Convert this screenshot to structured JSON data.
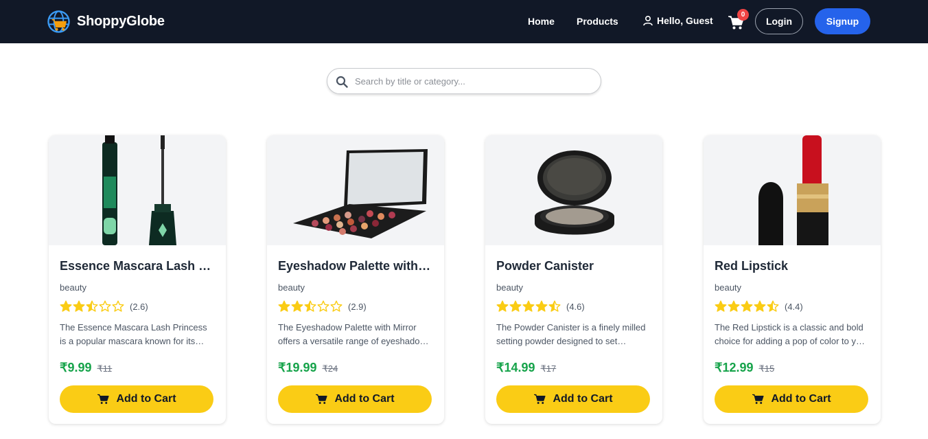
{
  "brand": {
    "name": "ShoppyGlobe",
    "logo_icon": "globe-cart-logo-icon"
  },
  "nav": {
    "home": "Home",
    "products": "Products",
    "user_greeting": "Hello, Guest",
    "user_icon": "user-icon",
    "cart_icon": "cart-icon",
    "cart_count": "0",
    "login": "Login",
    "signup": "Signup"
  },
  "colors": {
    "navbar": "#111827",
    "accent": "#2563eb",
    "badge": "#ef4444",
    "price": "#16a34a",
    "button": "#facc15",
    "star": "#facc15"
  },
  "search": {
    "placeholder": "Search by title or category...",
    "value": "",
    "icon": "search-icon"
  },
  "products": [
    {
      "title": "Essence Mascara Lash Princess",
      "category": "beauty",
      "rating": 2.6,
      "rating_label": "(2.6)",
      "description": "The Essence Mascara Lash Princess is a popular mascara known for its volumizing and lengthening effects.",
      "price": "₹9.99",
      "old_price": "₹11",
      "button": "Add to Cart"
    },
    {
      "title": "Eyeshadow Palette with Mirror",
      "category": "beauty",
      "rating": 2.9,
      "rating_label": "(2.9)",
      "description": "The Eyeshadow Palette with Mirror offers a versatile range of eyeshadow shades for creating stunning eye looks.",
      "price": "₹19.99",
      "old_price": "₹24",
      "button": "Add to Cart"
    },
    {
      "title": "Powder Canister",
      "category": "beauty",
      "rating": 4.6,
      "rating_label": "(4.6)",
      "description": "The Powder Canister is a finely milled setting powder designed to set makeup and control shine.",
      "price": "₹14.99",
      "old_price": "₹17",
      "button": "Add to Cart"
    },
    {
      "title": "Red Lipstick",
      "category": "beauty",
      "rating": 4.4,
      "rating_label": "(4.4)",
      "description": "The Red Lipstick is a classic and bold choice for adding a pop of color to your lips.",
      "price": "₹12.99",
      "old_price": "₹15",
      "button": "Add to Cart"
    }
  ]
}
